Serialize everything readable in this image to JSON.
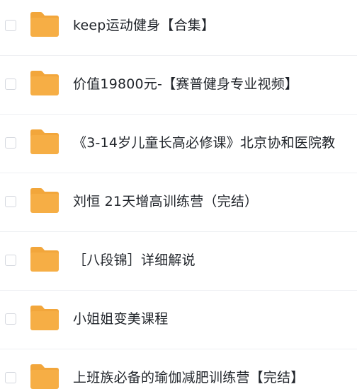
{
  "file_list": {
    "folder_icon": "folder-icon",
    "folder_color": "#f6ae45",
    "folder_tab_color": "#f2a63b",
    "items": [
      {
        "name": "keep运动健身【合集】"
      },
      {
        "name": "价值19800元-【赛普健身专业视频】"
      },
      {
        "name": "《3-14岁儿童长高必修课》北京协和医院教"
      },
      {
        "name": "刘恒 21天增高训练营（完结）"
      },
      {
        "name": "［八段锦］详细解说"
      },
      {
        "name": "小姐姐变美课程"
      },
      {
        "name": "上班族必备的瑜伽减肥训练营【完结】"
      }
    ]
  }
}
